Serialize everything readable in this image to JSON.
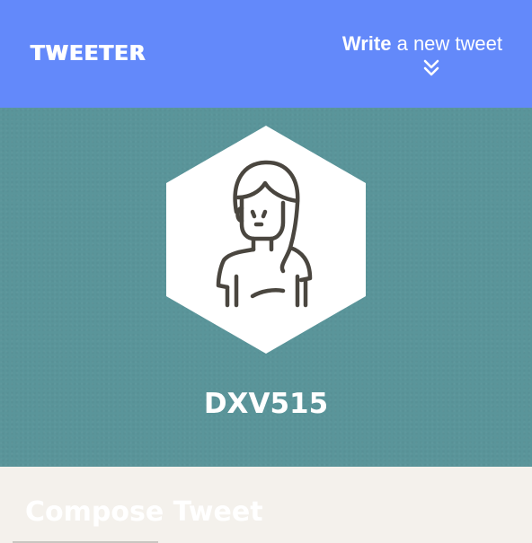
{
  "navbar": {
    "brand": "TWEETER",
    "write_link": {
      "strong": "Write",
      "rest": " a new tweet"
    },
    "icon": "double-chevron-down-icon",
    "background": "#6389fa"
  },
  "profile": {
    "background": "#5a959a",
    "avatar_icon": "woman-avatar-icon",
    "username": "DXV515"
  },
  "compose": {
    "title": "Compose Tweet",
    "background": "#f4f1ec"
  }
}
